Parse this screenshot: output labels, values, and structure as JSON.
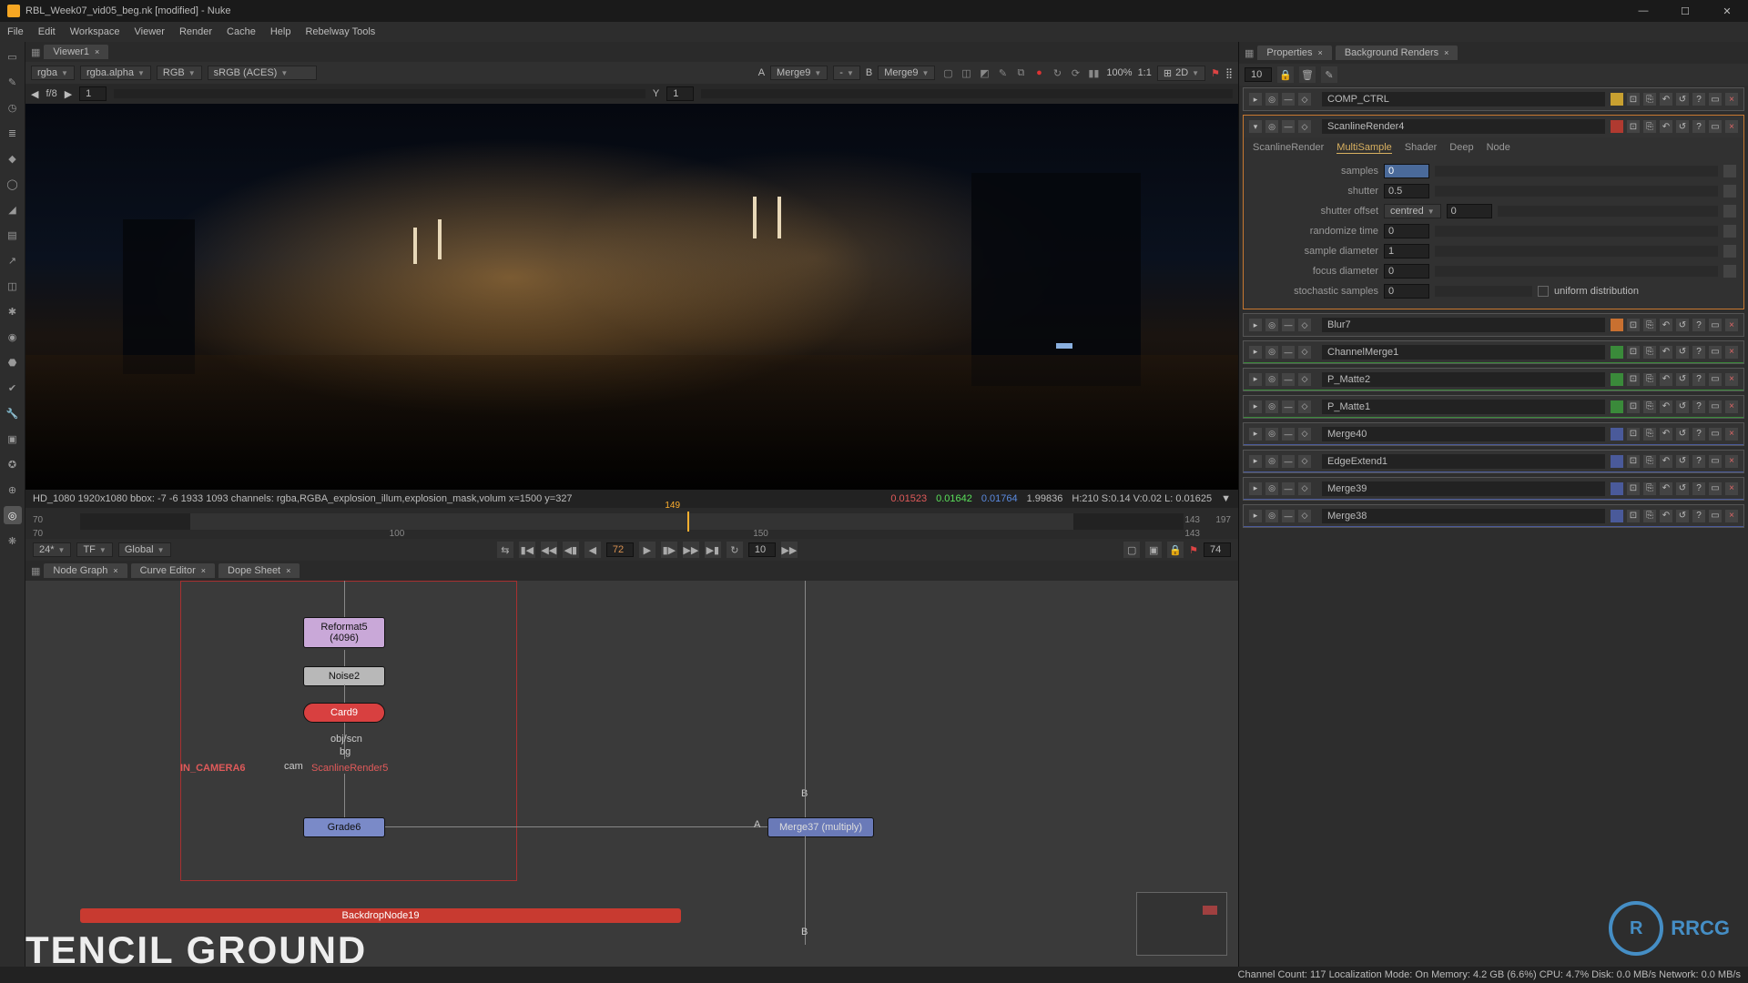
{
  "title": "RBL_Week07_vid05_beg.nk [modified] - Nuke",
  "menus": [
    "File",
    "Edit",
    "Workspace",
    "Viewer",
    "Render",
    "Cache",
    "Help",
    "Rebelway Tools"
  ],
  "viewer_tab": "Viewer1",
  "viewer_ctrl": {
    "layer": "rgba",
    "channel": "rgba.alpha",
    "colorspace": "RGB",
    "lut": "sRGB (ACES)",
    "a_label": "A",
    "a_node": "Merge9",
    "b_label": "B",
    "b_node": "Merge9",
    "zoom": "100%",
    "ratio": "1:1",
    "mode": "2D"
  },
  "viewer_ruler": {
    "f": "f/8",
    "frame": "1",
    "y_label": "Y",
    "y_val": "1"
  },
  "viewer_info": {
    "text": "HD_1080 1920x1080  bbox: -7 -6 1933 1093 channels: rgba,RGBA_explosion_illum,explosion_mask,volum  x=1500 y=327",
    "r": "0.01523",
    "g": "0.01642",
    "b": "0.01764",
    "l": "1.99836",
    "hsv": "H:210 S:0.14 V:0.02  L: 0.01625"
  },
  "timeline": {
    "start": "70",
    "mid": "100",
    "end": "197",
    "rstart": "70",
    "rend": "143",
    "cur": "143",
    "play": "149",
    "late": "150"
  },
  "transport": {
    "scale": "24*",
    "tf": "TF",
    "mode": "Global",
    "frame": "72",
    "step": "10",
    "endframe": "74"
  },
  "graph_tabs": [
    "Node Graph",
    "Curve Editor",
    "Dope Sheet"
  ],
  "nodes": {
    "reformat": "Reformat5\n(4096)",
    "noise": "Noise2",
    "card": "Card9",
    "objscn": "obj/scn",
    "bg": "bg",
    "cam_lbl": "cam",
    "scan": "ScanlineRender5",
    "in_camera": "IN_CAMERA6",
    "grade": "Grade6",
    "merge": "Merge37 (multiply)",
    "mergeA": "A",
    "mergeB": "B",
    "mergeB2": "B",
    "backdrop": "BackdropNode19",
    "bigtext": "TENCIL GROUND"
  },
  "prop_tabs": {
    "props": "Properties",
    "bg": "Background Renders"
  },
  "prop_count": "10",
  "panels": [
    {
      "name": "COMP_CTRL"
    },
    {
      "name": "ScanlineRender4",
      "expanded": true
    },
    {
      "name": "Blur7"
    },
    {
      "name": "ChannelMerge1"
    },
    {
      "name": "P_Matte2"
    },
    {
      "name": "P_Matte1"
    },
    {
      "name": "Merge40"
    },
    {
      "name": "EdgeExtend1"
    },
    {
      "name": "Merge39"
    },
    {
      "name": "Merge38"
    }
  ],
  "scan_tabs": [
    "ScanlineRender",
    "MultiSample",
    "Shader",
    "Deep",
    "Node"
  ],
  "scan_active": "MultiSample",
  "knobs": {
    "samples": {
      "label": "samples",
      "val": "0"
    },
    "shutter": {
      "label": "shutter",
      "val": "0.5"
    },
    "shutter_offset": {
      "label": "shutter offset",
      "val": "centred",
      "num": "0"
    },
    "randomize_time": {
      "label": "randomize time",
      "val": "0"
    },
    "sample_diameter": {
      "label": "sample diameter",
      "val": "1"
    },
    "focus_diameter": {
      "label": "focus diameter",
      "val": "0"
    },
    "stochastic": {
      "label": "stochastic samples",
      "val": "0",
      "check": "uniform distribution"
    }
  },
  "status": {
    "left": "",
    "right": "Channel Count: 117 Localization Mode: On Memory: 4.2 GB (6.6%) CPU: 4.7% Disk: 0.0 MB/s Network: 0.0 MB/s"
  },
  "watermark": "RRCG"
}
